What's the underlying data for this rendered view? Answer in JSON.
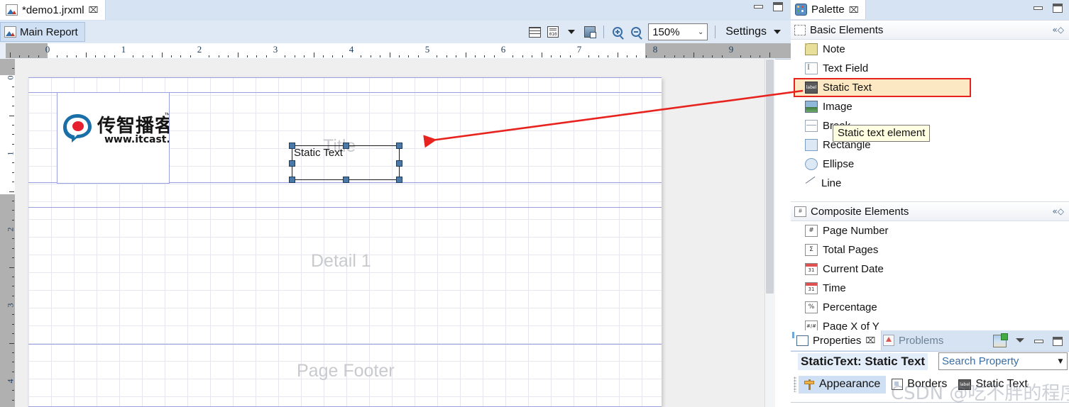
{
  "editor": {
    "tab": {
      "title": "*demo1.jrxml",
      "close_glyph": "⌧",
      "icon": "jrxml-file-icon"
    },
    "window_controls": {
      "minimize": "minimize-icon",
      "maximize": "maximize-icon"
    },
    "toolbar": {
      "main_report_label": "Main Report",
      "buttons": [
        {
          "name": "dataset-and-query-button",
          "icon": "grid-list-icon"
        },
        {
          "name": "compile-report-button",
          "icon": "binary-doc-icon"
        },
        {
          "name": "compile-dropdown-button",
          "icon": "chevron-down-icon"
        },
        {
          "name": "export-report-button",
          "icon": "export-doc-icon"
        },
        {
          "name": "zoom-in-button",
          "icon": "zoom-in-icon"
        },
        {
          "name": "zoom-out-button",
          "icon": "zoom-out-icon"
        }
      ],
      "zoom_value": "150%",
      "zoom_arrow": "⌄",
      "settings_label": "Settings",
      "settings_arrow": "▼"
    },
    "rulers": {
      "horizontal_numbers": [
        "0",
        "1",
        "2",
        "3",
        "4",
        "5",
        "6",
        "7",
        "8",
        "9"
      ],
      "vertical_numbers": [
        "0",
        "1",
        "2",
        "3",
        "4"
      ]
    },
    "canvas": {
      "bands": [
        {
          "label": "Title",
          "name": "band-title"
        },
        {
          "label": "Detail 1",
          "name": "band-detail-1"
        },
        {
          "label": "Page Footer",
          "name": "band-page-footer"
        }
      ],
      "logo": {
        "cn_text": "传智播客",
        "tm": "™",
        "url": "www.itcast.cn"
      },
      "selected_element": {
        "label": "Static Text",
        "handle_count": 8
      }
    }
  },
  "palette": {
    "tab": {
      "title": "Palette",
      "close_glyph": "⌧",
      "icon": "palette-icon"
    },
    "window_controls": {
      "minimize": "minimize-icon",
      "maximize": "maximize-icon"
    },
    "sections": [
      {
        "title": "Basic Elements",
        "icon": "dashed-box-icon",
        "collapse_glyph": "«◇",
        "items": [
          {
            "label": "Note",
            "icon": "note-icon",
            "selected": false
          },
          {
            "label": "Text Field",
            "icon": "text-field-icon",
            "selected": false
          },
          {
            "label": "Static Text",
            "icon": "static-text-icon",
            "selected": true
          },
          {
            "label": "Image",
            "icon": "image-icon",
            "selected": false
          },
          {
            "label": "Break",
            "icon": "break-icon",
            "selected": false
          },
          {
            "label": "Rectangle",
            "icon": "rectangle-icon",
            "selected": false
          },
          {
            "label": "Ellipse",
            "icon": "ellipse-icon",
            "selected": false
          },
          {
            "label": "Line",
            "icon": "line-icon",
            "selected": false
          }
        ]
      },
      {
        "title": "Composite Elements",
        "icon": "hash-box-icon",
        "collapse_glyph": "«◇",
        "items": [
          {
            "label": "Page Number",
            "icon": "hash-icon",
            "selected": false
          },
          {
            "label": "Total Pages",
            "icon": "sigma-icon",
            "selected": false
          },
          {
            "label": "Current Date",
            "icon": "calendar-icon",
            "selected": false
          },
          {
            "label": "Time",
            "icon": "calendar-icon",
            "selected": false
          },
          {
            "label": "Percentage",
            "icon": "percent-icon",
            "selected": false
          },
          {
            "label": "Page X of Y",
            "icon": "hash-slash-hash-icon",
            "selected": false
          }
        ]
      }
    ],
    "tooltip": "Static text element",
    "scroll_down_glyph": "▼"
  },
  "properties": {
    "tabs": [
      {
        "label": "Properties",
        "active": true,
        "icon": "properties-icon",
        "close_glyph": "⌧"
      },
      {
        "label": "Problems",
        "active": false,
        "icon": "problems-icon"
      }
    ],
    "window_controls": {
      "new_view": "new-view-icon",
      "menu": "view-menu-icon",
      "minimize": "minimize-icon",
      "maximize": "maximize-icon"
    },
    "title": "StaticText: Static Text",
    "search": {
      "placeholder": "Search Property",
      "value": "Search Property",
      "arrow": "▼"
    },
    "prop_tabs": [
      {
        "label": "Appearance",
        "active": true,
        "icon": "appearance-icon"
      },
      {
        "label": "Borders",
        "active": false,
        "icon": "borders-icon"
      },
      {
        "label": "Static Text",
        "active": false,
        "icon": "static-text-icon"
      }
    ]
  },
  "watermark": {
    "text": "CSDN @吃不胖的程序员"
  },
  "colors": {
    "accent": "#cfe0f4",
    "annotation_red": "#e8221d",
    "selection_fill": "#fce9c4",
    "handle": "#4a79a8",
    "band_line": "#9aa0e0"
  }
}
